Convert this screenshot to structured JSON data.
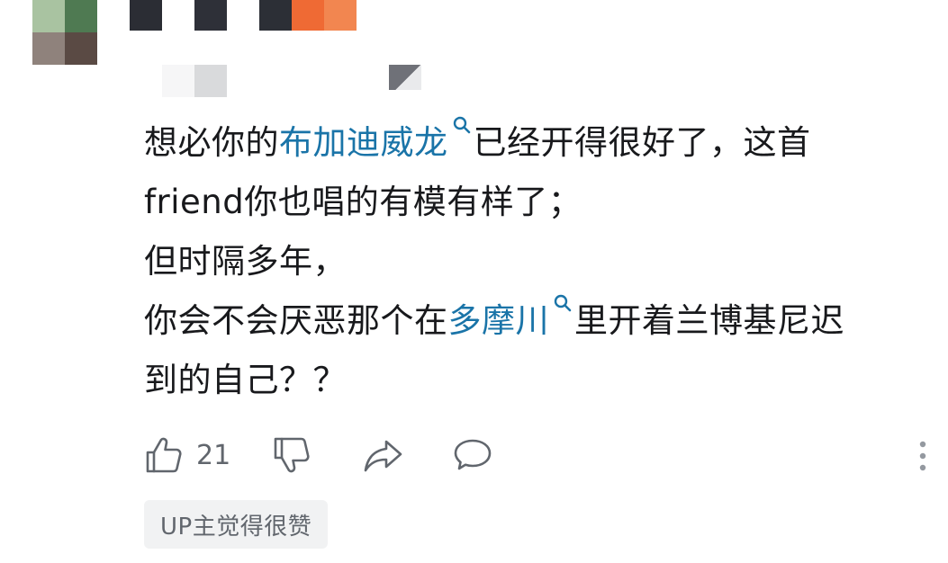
{
  "comment": {
    "line1_pre": "想必你的",
    "line1_link": "布加迪威龙",
    "line1_post": "已经开得很好了，这首",
    "line2": "friend你也唱的有模有样了；",
    "line3": "但时隔多年，",
    "line4_pre": "你会不会厌恶那个在",
    "line4_link": "多摩川",
    "line4_post": "里开着兰博基尼迟",
    "line5": "到的自己？？"
  },
  "actions": {
    "like_count": "21",
    "like_icon": "thumbs-up-icon",
    "dislike_icon": "thumbs-down-icon",
    "share_icon": "share-icon",
    "reply_icon": "comment-bubble-icon",
    "more_icon": "more-vertical-icon"
  },
  "badge": {
    "label": "UP主觉得很赞"
  },
  "colors": {
    "text": "#18191c",
    "link": "#1a74a8",
    "muted": "#61666d",
    "badge_bg": "#f1f2f3"
  }
}
